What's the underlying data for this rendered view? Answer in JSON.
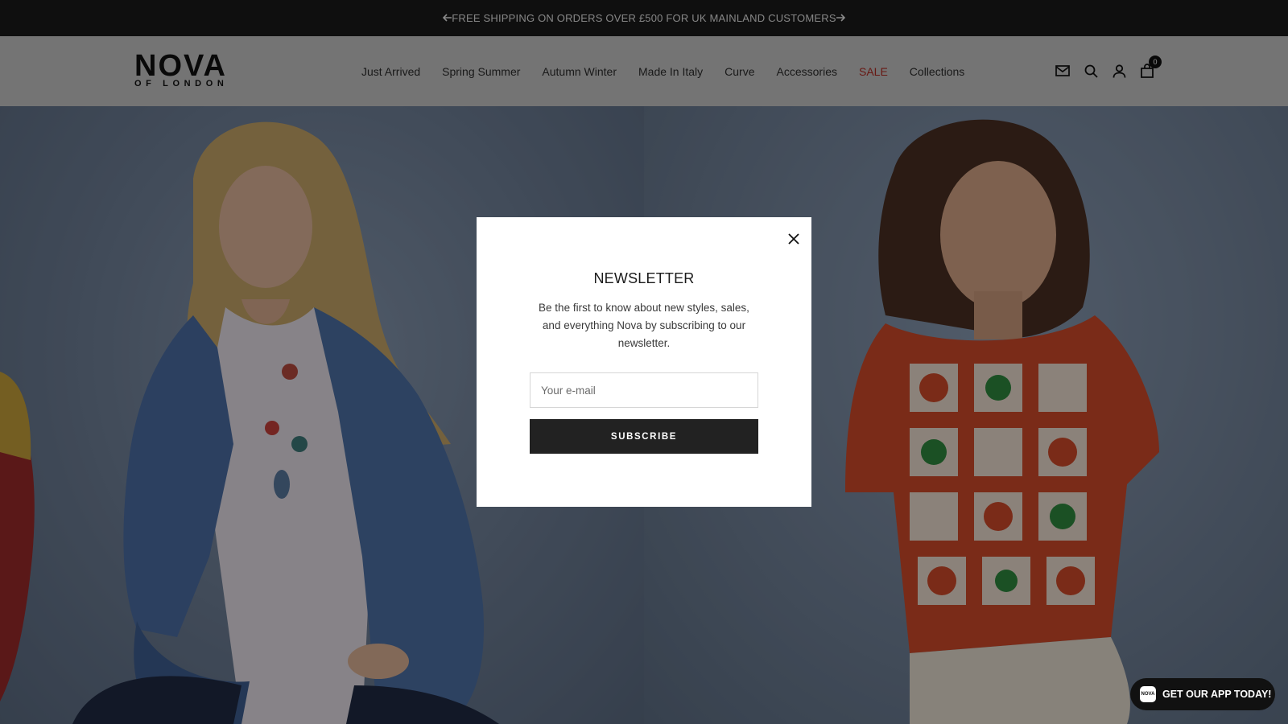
{
  "announcement": {
    "message": "FREE SHIPPING ON ORDERS OVER £500 FOR UK MAINLAND CUSTOMERS",
    "prev_icon": "arrow-left-icon",
    "next_icon": "arrow-right-icon"
  },
  "header": {
    "logo": {
      "line1": "NOVA",
      "line2": "OF LONDON"
    },
    "nav": [
      {
        "label": "Just Arrived"
      },
      {
        "label": "Spring Summer"
      },
      {
        "label": "Autumn Winter"
      },
      {
        "label": "Made In Italy"
      },
      {
        "label": "Curve"
      },
      {
        "label": "Accessories"
      },
      {
        "label": "SALE",
        "color": "#b22a22"
      },
      {
        "label": "Collections"
      }
    ],
    "icons": [
      "mail-icon",
      "search-icon",
      "account-icon",
      "cart-icon"
    ],
    "cart_count": "0"
  },
  "modal": {
    "title": "NEWSLETTER",
    "description": "Be the first to know about new styles, sales, and everything Nova by subscribing to our newsletter.",
    "email_placeholder": "Your e-mail",
    "email_value": "",
    "subscribe_label": "SUBSCRIBE",
    "close_icon": "close-icon"
  },
  "app_badge": {
    "logo_text": "NOVA",
    "label": "GET OUR APP TODAY!"
  },
  "colors": {
    "announcement_bg": "#1b1b1b",
    "header_bg": "#c9c9c9",
    "sale": "#b22a22",
    "button_bg": "#222222"
  }
}
